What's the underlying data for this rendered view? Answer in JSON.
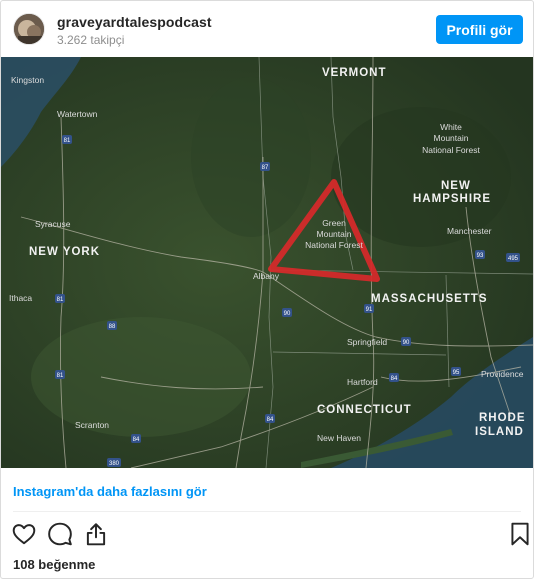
{
  "post": {
    "username": "graveyardtalespodcast",
    "followers": "3.262 takipçi",
    "profile_button": "Profili gör",
    "more_link": "Instagram'da daha fazlasını gör",
    "likes": "108 beğenme"
  },
  "icons": {
    "avatar": "avatar-image",
    "like": "heart-icon",
    "comment": "comment-icon",
    "share": "share-icon",
    "save": "bookmark-icon"
  },
  "colors": {
    "accent": "#0095f6",
    "triangle": "#d42a2a"
  },
  "map": {
    "states": {
      "vermont": "VERMONT",
      "new_york": "NEW YORK",
      "new_hampshire_1": "NEW",
      "new_hampshire_2": "HAMPSHIRE",
      "massachusetts": "MASSACHUSETTS",
      "connecticut": "CONNECTICUT",
      "rhode_1": "RHODE",
      "rhode_2": "ISLAND"
    },
    "places": {
      "kingston": "Kingston",
      "watertown": "Watertown",
      "syracuse": "Syracuse",
      "ithaca": "Ithaca",
      "albany": "Albany",
      "springfield": "Springfield",
      "hartford": "Hartford",
      "new_haven": "New Haven",
      "scranton": "Scranton",
      "manchester": "Manchester",
      "providence": "Providence",
      "green_1": "Green",
      "green_2": "Mountain",
      "green_3": "National Forest",
      "white_1": "White",
      "white_2": "Mountain",
      "white_3": "National Forest"
    },
    "shields": {
      "i81a": "81",
      "i81b": "81",
      "i81c": "81",
      "i87": "87",
      "i88": "88",
      "i90a": "90",
      "i90b": "90",
      "i91": "91",
      "i84a": "84",
      "i84b": "84",
      "i84c": "84",
      "i93": "93",
      "i495": "495",
      "i95": "95",
      "i380": "380"
    }
  }
}
